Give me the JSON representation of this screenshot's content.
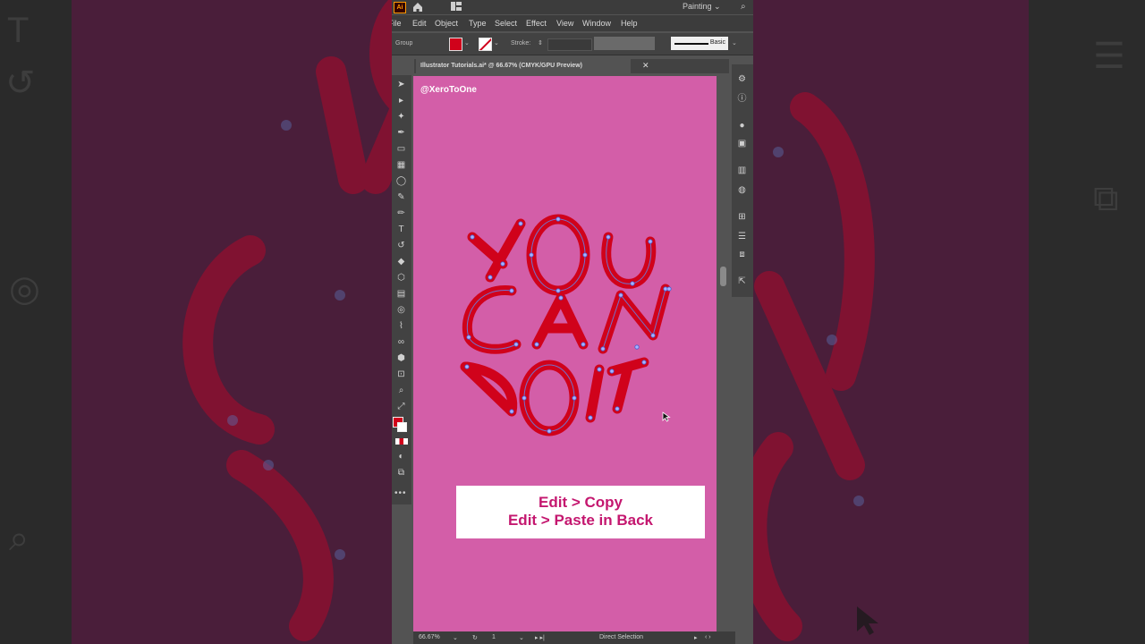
{
  "app": {
    "logo": "Ai",
    "workspace": "Painting",
    "menu": [
      "File",
      "Edit",
      "Object",
      "Type",
      "Select",
      "Effect",
      "View",
      "Window",
      "Help"
    ],
    "control_bar": {
      "selection_label": "Group",
      "stroke_label": "Stroke:",
      "brush_label": "Basic",
      "fill_color": "#d0021b"
    },
    "document_tab": "Illustrator Tutorials.ai* @ 66.67% (CMYK/GPU Preview)",
    "artboard": {
      "credit": "@XeroToOne",
      "background": "#d35ea8",
      "letter_color": "#d0021b",
      "caption_line1": "Edit > Copy",
      "caption_line2": "Edit > Paste in Back"
    },
    "status": {
      "zoom": "66.67%",
      "artboard_number": "1",
      "current_tool": "Direct Selection"
    }
  },
  "icons": {
    "home": "home-icon",
    "search": "search-icon",
    "selection_tool": "selection-tool-icon",
    "direct_selection_tool": "direct-selection-tool-icon",
    "pen_tool": "pen-tool-icon",
    "type_tool": "type-tool-icon",
    "zoom_tool": "zoom-tool-icon"
  }
}
